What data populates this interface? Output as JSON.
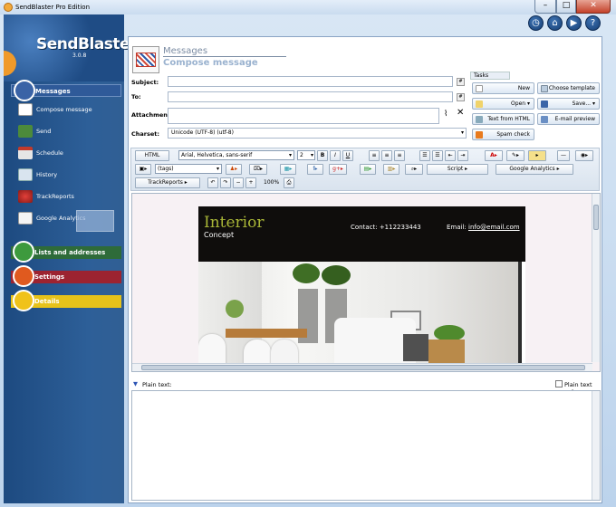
{
  "window": {
    "title": "SendBlaster Pro Edition",
    "minimize": "–",
    "maximize": "□",
    "close": "✕"
  },
  "logo": {
    "name": "SendBlaster3",
    "version": "3.0.8"
  },
  "sidebar": {
    "messages_header": "Messages",
    "items": [
      {
        "label": "Compose message",
        "icon": "compose-icon"
      },
      {
        "label": "Send",
        "icon": "send-icon"
      },
      {
        "label": "Schedule",
        "icon": "calendar-icon"
      },
      {
        "label": "History",
        "icon": "history-icon"
      },
      {
        "label": "TrackReports",
        "icon": "track-icon"
      },
      {
        "label": "Google Analytics",
        "icon": "analytics-icon"
      }
    ],
    "lists_header": "Lists and addresses",
    "settings_header": "Settings",
    "details_header": "Details",
    "colors": {
      "messages": "#3a63a6",
      "lists": "#2e6b39",
      "settings": "#9c2330",
      "details": "#e6c21a"
    }
  },
  "top_icons": [
    "clock-icon",
    "home-icon",
    "video-icon",
    "help-icon"
  ],
  "header": {
    "title": "Messages",
    "subtitle": "Compose message"
  },
  "form": {
    "subject_label": "Subject:",
    "subject_value": "",
    "to_label": "To:",
    "to_value": "",
    "attachments_label": "Attachments:",
    "attachments_value": "",
    "charset_label": "Charset:",
    "charset_value": "Unicode (UTF-8)     (utf-8)",
    "hash": "#"
  },
  "tasks": {
    "label": "Tasks",
    "buttons": {
      "new": "New",
      "choose_template": "Choose template",
      "open": "Open",
      "save": "Save...",
      "text_from_html": "Text from HTML",
      "email_preview": "E-mail preview",
      "spam_check": "Spam check"
    }
  },
  "toolbar": {
    "html": "HTML",
    "font": "Arial, Helvetica, sans-serif",
    "size": "2",
    "bold": "B",
    "italic": "I",
    "underline": "U",
    "tags": "(tags)",
    "script": "Script",
    "google_analytics": "Google Analytics",
    "trackreports": "TrackReports",
    "zoom": "100%"
  },
  "document": {
    "title": "Interior",
    "subtitle": "Concept",
    "contact": "Contact:  +112233443",
    "email_label": "Email:",
    "email_value": "info@email.com"
  },
  "plain": {
    "label": "Plain text:",
    "only_label": "Plain text only"
  }
}
